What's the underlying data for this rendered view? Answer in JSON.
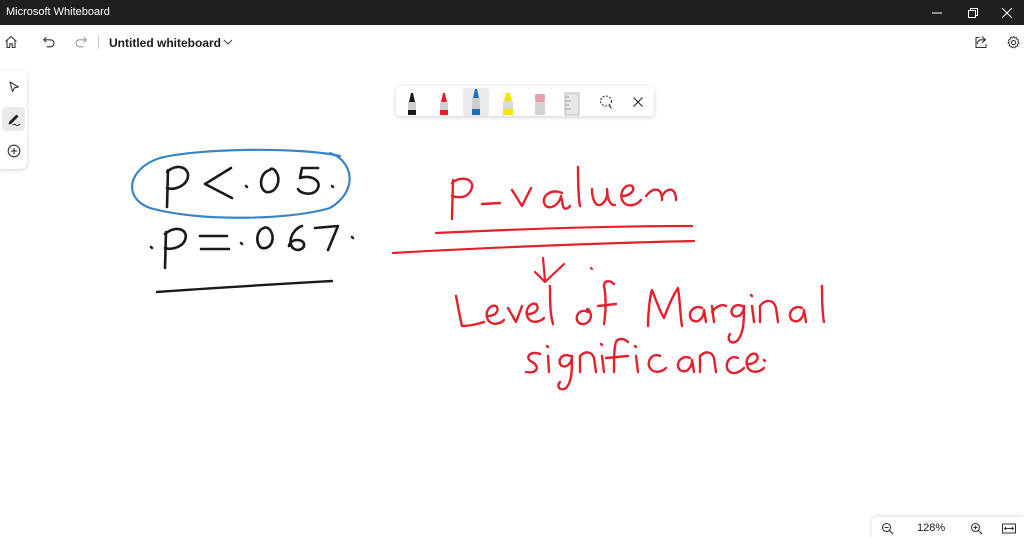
{
  "window": {
    "title": "Microsoft Whiteboard"
  },
  "toolbar": {
    "document_title": "Untitled whiteboard",
    "icons": [
      "home-icon",
      "undo-icon",
      "redo-icon",
      "chevron-down-icon",
      "share-icon",
      "gear-icon"
    ]
  },
  "left_rail": {
    "items": [
      "select-icon",
      "pen-icon",
      "add-icon"
    ],
    "active": "pen-icon"
  },
  "pen_tray": {
    "pens": [
      {
        "name": "black-pen",
        "color": "#1a1a1a"
      },
      {
        "name": "red-pen",
        "color": "#e3202c"
      },
      {
        "name": "blue-pen",
        "color": "#1b6fb8"
      },
      {
        "name": "yellow-highlighter",
        "color": "#f2e600"
      },
      {
        "name": "eraser",
        "color": "#e8a0a6"
      },
      {
        "name": "ruler",
        "color": "#bdbdbd"
      }
    ],
    "selected": "blue-pen"
  },
  "ink": {
    "black_color": "#1a1a1a",
    "blue_color": "#3a84c6",
    "red_color": "#e3202c"
  },
  "zoom": {
    "level": "128%"
  }
}
